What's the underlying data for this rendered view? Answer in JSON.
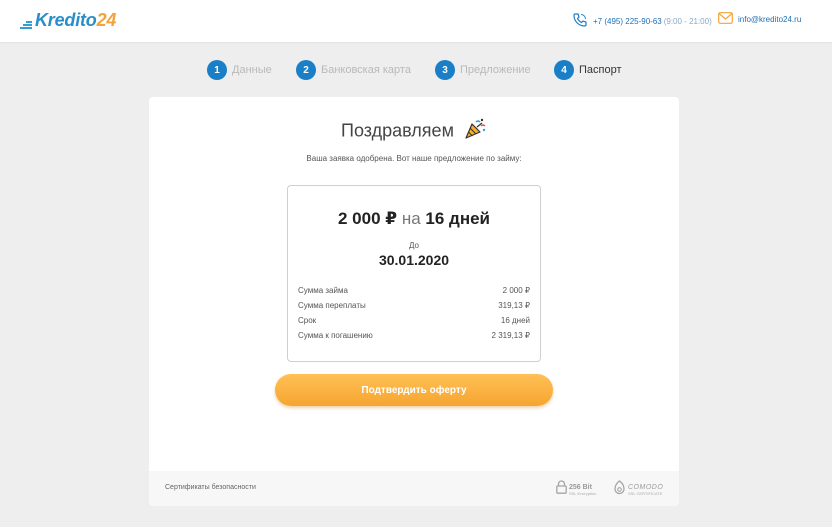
{
  "header": {
    "logo_main": "Kredito",
    "logo_num": "24",
    "phone": "+7 (495) 225-90-63",
    "phone_hours": "(9:00 - 21:00)",
    "email": "info@kredito24.ru",
    "phone_icon": "phone-icon",
    "email_icon": "envelope-icon"
  },
  "steps": [
    {
      "num": "1",
      "label": "Данные"
    },
    {
      "num": "2",
      "label": "Банковская карта"
    },
    {
      "num": "3",
      "label": "Предложение"
    },
    {
      "num": "4",
      "label": "Паспорт"
    }
  ],
  "card": {
    "title": "Поздравляем",
    "title_icon": "party-popper-icon",
    "subtitle": "Ваша заявка одобрена. Вот наше предложение по займу:",
    "offer": {
      "amount": "2 000 ₽",
      "on": "на",
      "term": "16 дней",
      "until_label": "До",
      "until_date": "30.01.2020",
      "rows": [
        {
          "label": "Сумма займа",
          "value": "2 000 ₽"
        },
        {
          "label": "Сумма переплаты",
          "value": "319,13 ₽"
        },
        {
          "label": "Срок",
          "value": "16 дней"
        },
        {
          "label": "Сумма к погашению",
          "value": "2 319,13 ₽"
        }
      ]
    },
    "confirm_label": "Подтвердить оферту",
    "footer": {
      "certificates_label": "Сертификаты безопасности",
      "ssl_badge": "256 Bit",
      "ssl_sub": "SSL Encryption",
      "comodo_badge": "COMODO",
      "comodo_sub": "SSL CERTIFICATE"
    }
  },
  "colors": {
    "brand_blue": "#1a7fc7",
    "brand_orange": "#f6a530",
    "background": "#eeeeee"
  }
}
